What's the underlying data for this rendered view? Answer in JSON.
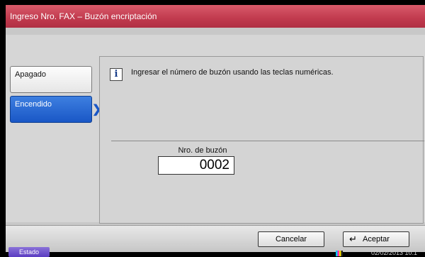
{
  "window": {
    "title": "Ingreso Nro. FAX – Buzón encriptación"
  },
  "options": {
    "off_label": "Apagado",
    "on_label": "Encendido",
    "selected": "on"
  },
  "info": {
    "icon": "info-icon",
    "message": "Ingresar el número de buzón usando las teclas numéricas."
  },
  "mailbox": {
    "label": "Nro. de buzón",
    "value": "0002"
  },
  "actions": {
    "cancel_label": "Cancelar",
    "accept_label": "Aceptar"
  },
  "status": {
    "status_label": "Estado",
    "datetime": "02/02/2013  10:1"
  },
  "colors": {
    "titlebar": "#c13a4e",
    "selected_option": "#1a57c6",
    "status_button": "#5a3cc2"
  }
}
